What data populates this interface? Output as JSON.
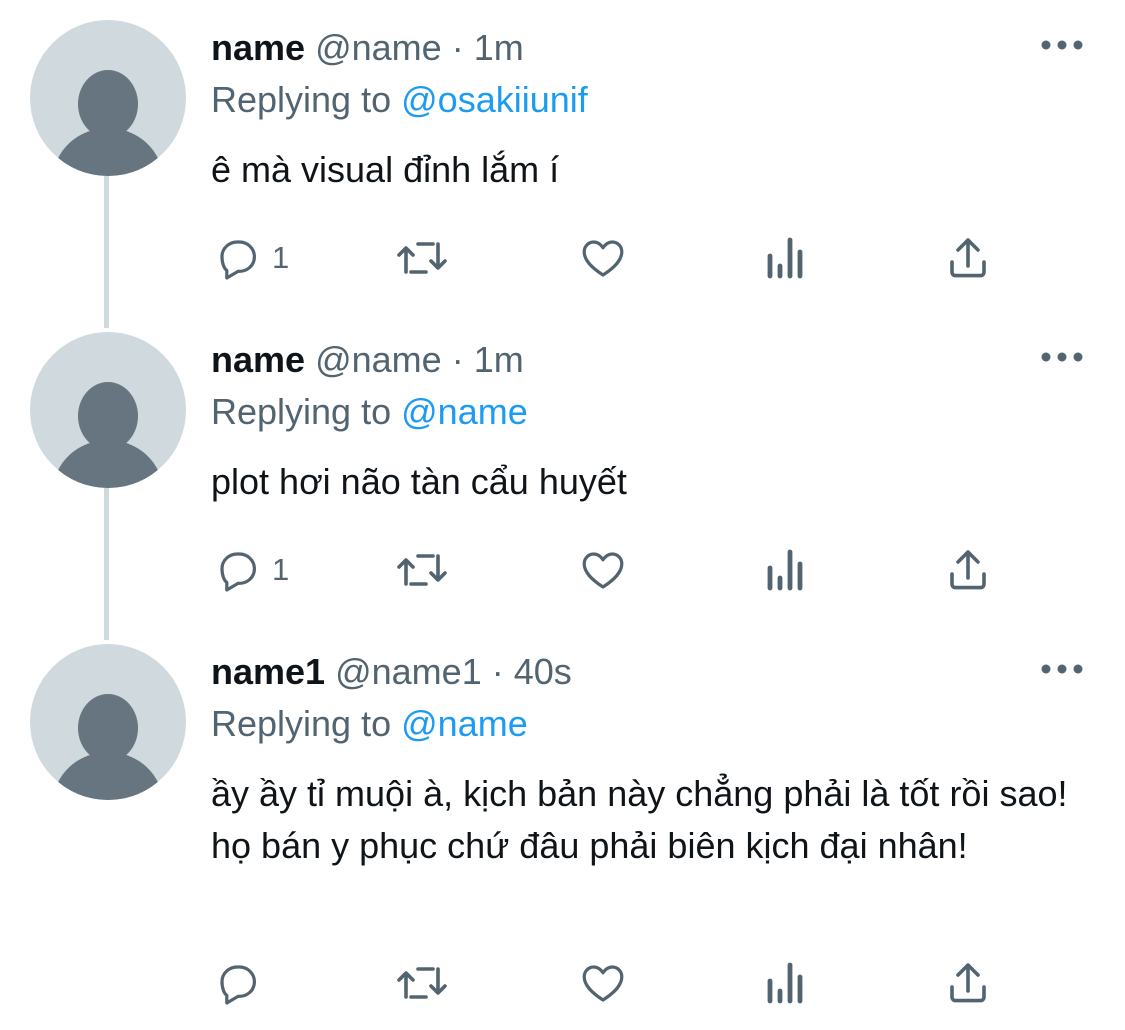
{
  "colors": {
    "text": "#0f1419",
    "secondary": "#536471",
    "link": "#1d9bf0",
    "avatar_bg": "#cfd9de",
    "avatar_fg": "#66757f"
  },
  "icons": [
    "reply-icon",
    "retweet-icon",
    "like-icon",
    "analytics-icon",
    "share-icon",
    "more-icon"
  ],
  "tweets": [
    {
      "display_name": "name",
      "handle": "@name",
      "separator": "·",
      "time": "1m",
      "replying_label": "Replying to",
      "replying_to": "@osakiiunif",
      "text": "ê mà visual đỉnh lắm í",
      "reply_count": "1"
    },
    {
      "display_name": "name",
      "handle": "@name",
      "separator": "·",
      "time": "1m",
      "replying_label": "Replying to",
      "replying_to": "@name",
      "text": "plot hơi não tàn cẩu huyết",
      "reply_count": "1"
    },
    {
      "display_name": "name1",
      "handle": "@name1",
      "separator": "·",
      "time": "40s",
      "replying_label": "Replying to",
      "replying_to": "@name",
      "text": "ầy ầy tỉ muội à, kịch bản này chẳng phải là tốt rồi sao! họ bán y phục chứ đâu phải biên kịch đại nhân!",
      "reply_count": ""
    }
  ]
}
